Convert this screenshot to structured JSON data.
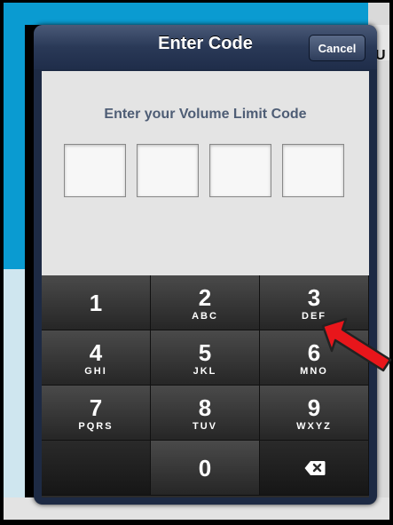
{
  "background": {
    "right_text": "U"
  },
  "dialog": {
    "title": "Enter Code",
    "cancel_label": "Cancel",
    "prompt": "Enter your Volume Limit Code",
    "code_boxes": [
      "",
      "",
      "",
      ""
    ]
  },
  "keypad": {
    "keys": [
      {
        "num": "1",
        "letters": ""
      },
      {
        "num": "2",
        "letters": "ABC"
      },
      {
        "num": "3",
        "letters": "DEF"
      },
      {
        "num": "4",
        "letters": "GHI"
      },
      {
        "num": "5",
        "letters": "JKL"
      },
      {
        "num": "6",
        "letters": "MNO"
      },
      {
        "num": "7",
        "letters": "PQRS"
      },
      {
        "num": "8",
        "letters": "TUV"
      },
      {
        "num": "9",
        "letters": "WXYZ"
      },
      {
        "num": "",
        "letters": ""
      },
      {
        "num": "0",
        "letters": ""
      },
      {
        "icon": "backspace-icon"
      }
    ]
  },
  "colors": {
    "annotation_arrow": "#e8161b",
    "title_bar": "#2a3957",
    "prompt_text": "#4e5d75"
  }
}
